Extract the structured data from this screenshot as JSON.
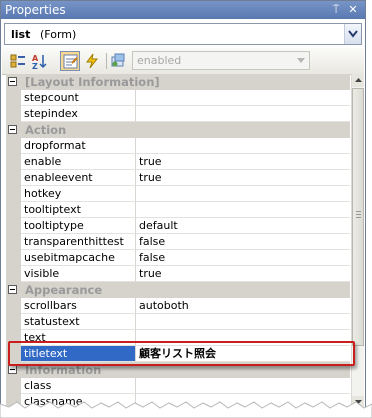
{
  "window": {
    "title": "Properties",
    "pin_glyph": "⍑",
    "close_glyph": "✕"
  },
  "object_selector": {
    "name": "list",
    "type": "(Form)"
  },
  "toolbar": {
    "tools": [
      {
        "icon": "categorized-icon"
      },
      {
        "icon": "alphabetical-icon"
      },
      {
        "icon": "properties-icon",
        "active": true
      },
      {
        "icon": "events-icon"
      },
      {
        "icon": "property-pages-icon"
      }
    ],
    "event_filter": {
      "value": "enabled"
    }
  },
  "grid": {
    "categories": [
      {
        "label": "[Layout Information]",
        "properties": [
          {
            "name": "stepcount",
            "value": ""
          },
          {
            "name": "stepindex",
            "value": ""
          }
        ]
      },
      {
        "label": "Action",
        "properties": [
          {
            "name": "dropformat",
            "value": ""
          },
          {
            "name": "enable",
            "value": "true"
          },
          {
            "name": "enableevent",
            "value": "true"
          },
          {
            "name": "hotkey",
            "value": ""
          },
          {
            "name": "tooltiptext",
            "value": ""
          },
          {
            "name": "tooltiptype",
            "value": "default"
          },
          {
            "name": "transparenthittest",
            "value": "false"
          },
          {
            "name": "usebitmapcache",
            "value": "false"
          },
          {
            "name": "visible",
            "value": "true"
          }
        ]
      },
      {
        "label": "Appearance",
        "properties": [
          {
            "name": "scrollbars",
            "value": "autoboth"
          },
          {
            "name": "statustext",
            "value": ""
          },
          {
            "name": "text",
            "value": ""
          },
          {
            "name": "titletext",
            "value": "顧客リスト照会",
            "selected": true
          }
        ]
      },
      {
        "label": "Information",
        "properties": [
          {
            "name": "class",
            "value": ""
          },
          {
            "name": "classname",
            "value": ""
          }
        ]
      }
    ]
  }
}
